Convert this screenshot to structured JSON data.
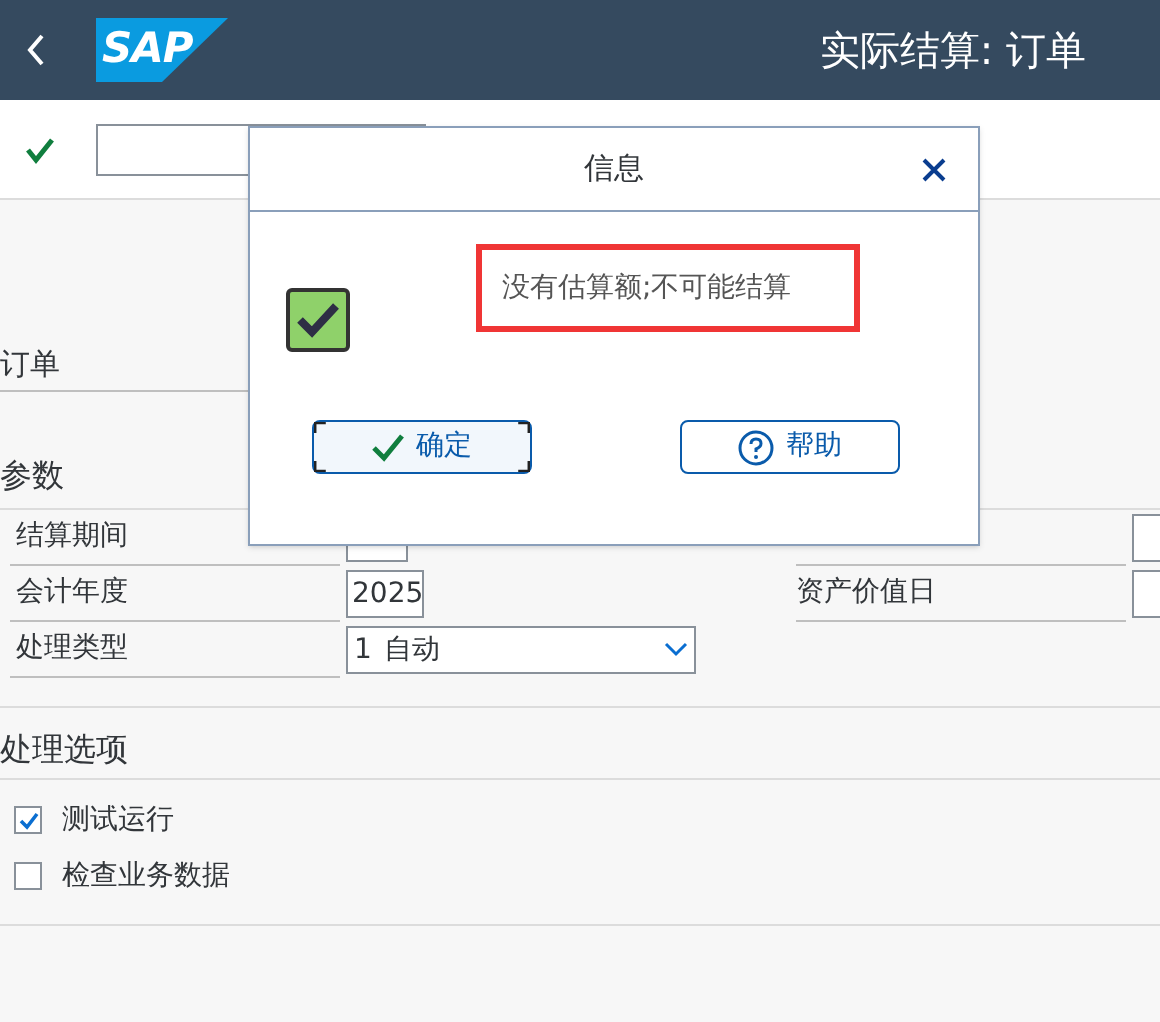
{
  "header": {
    "logo": "SAP",
    "title": "实际结算: 订单"
  },
  "order_label": "订单",
  "parameters": {
    "title": "参数",
    "rows": [
      {
        "label": "结算期间",
        "kind": "text",
        "value": ""
      },
      {
        "label": "会计年度",
        "kind": "text",
        "value": "2025"
      },
      {
        "label": "处理类型",
        "kind": "dropdown",
        "key": "1",
        "value": "自动"
      }
    ],
    "right_rows": [
      {
        "label": "资产价值日",
        "value": ""
      }
    ]
  },
  "options": {
    "title": "处理选项",
    "items": [
      {
        "label": "测试运行",
        "checked": true
      },
      {
        "label": "检查业务数据",
        "checked": false
      }
    ]
  },
  "dialog": {
    "title": "信息",
    "message": "没有估算额;不可能结算",
    "highlighted": true,
    "buttons": [
      {
        "label": "确定",
        "kind": "confirm",
        "focused": true
      },
      {
        "label": "帮助",
        "kind": "help",
        "focused": false
      }
    ]
  }
}
